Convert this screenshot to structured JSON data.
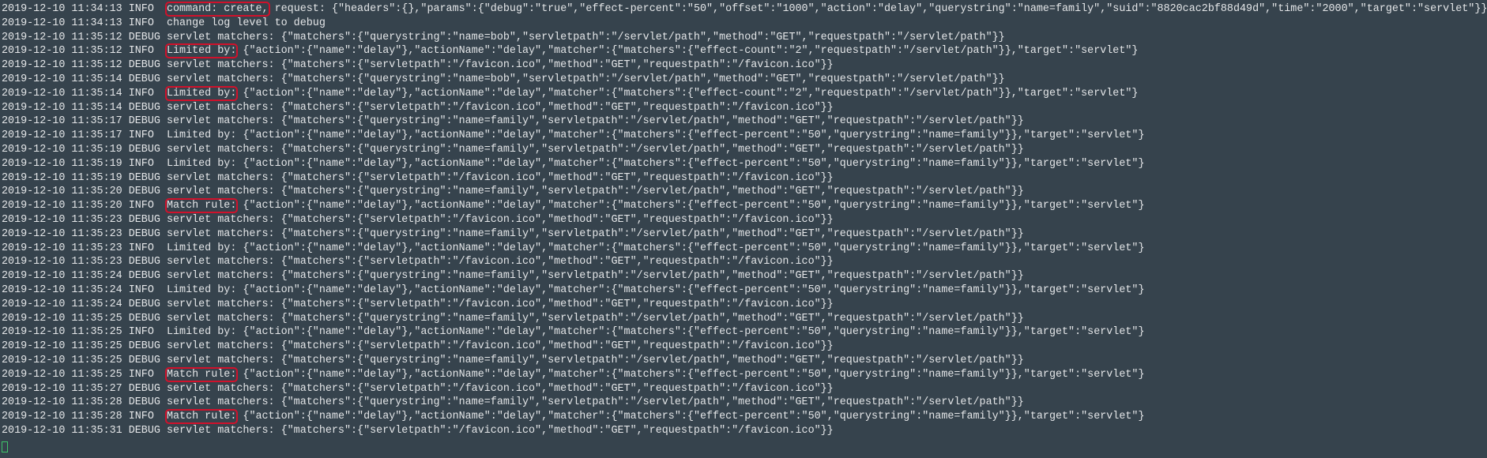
{
  "terminal": {
    "lines": [
      {
        "ts": "2019-12-10 11:34:13",
        "level": "INFO ",
        "prefix": "command: create,",
        "rest": " request: {\"headers\":{},\"params\":{\"debug\":\"true\",\"effect-percent\":\"50\",\"offset\":\"1000\",\"action\":\"delay\",\"querystring\":\"name=family\",\"suid\":\"8820cac2bf88d49d\",\"time\":\"2000\",\"target\":\"servlet\"}}",
        "boxed": true
      },
      {
        "ts": "2019-12-10 11:34:13",
        "level": "INFO ",
        "prefix": "change log level to debug",
        "rest": "",
        "boxed": false
      },
      {
        "ts": "2019-12-10 11:35:12",
        "level": "DEBUG",
        "prefix": "servlet matchers:",
        "rest": " {\"matchers\":{\"querystring\":\"name=bob\",\"servletpath\":\"/servlet/path\",\"method\":\"GET\",\"requestpath\":\"/servlet/path\"}}",
        "boxed": false
      },
      {
        "ts": "2019-12-10 11:35:12",
        "level": "INFO ",
        "prefix": "Limited by:",
        "rest": " {\"action\":{\"name\":\"delay\"},\"actionName\":\"delay\",\"matcher\":{\"matchers\":{\"effect-count\":\"2\",\"requestpath\":\"/servlet/path\"}},\"target\":\"servlet\"}",
        "boxed": true
      },
      {
        "ts": "2019-12-10 11:35:12",
        "level": "DEBUG",
        "prefix": "servlet matchers:",
        "rest": " {\"matchers\":{\"servletpath\":\"/favicon.ico\",\"method\":\"GET\",\"requestpath\":\"/favicon.ico\"}}",
        "boxed": false
      },
      {
        "ts": "2019-12-10 11:35:14",
        "level": "DEBUG",
        "prefix": "servlet matchers:",
        "rest": " {\"matchers\":{\"querystring\":\"name=bob\",\"servletpath\":\"/servlet/path\",\"method\":\"GET\",\"requestpath\":\"/servlet/path\"}}",
        "boxed": false
      },
      {
        "ts": "2019-12-10 11:35:14",
        "level": "INFO ",
        "prefix": "Limited by:",
        "rest": " {\"action\":{\"name\":\"delay\"},\"actionName\":\"delay\",\"matcher\":{\"matchers\":{\"effect-count\":\"2\",\"requestpath\":\"/servlet/path\"}},\"target\":\"servlet\"}",
        "boxed": true
      },
      {
        "ts": "2019-12-10 11:35:14",
        "level": "DEBUG",
        "prefix": "servlet matchers:",
        "rest": " {\"matchers\":{\"servletpath\":\"/favicon.ico\",\"method\":\"GET\",\"requestpath\":\"/favicon.ico\"}}",
        "boxed": false
      },
      {
        "ts": "2019-12-10 11:35:17",
        "level": "DEBUG",
        "prefix": "servlet matchers:",
        "rest": " {\"matchers\":{\"querystring\":\"name=family\",\"servletpath\":\"/servlet/path\",\"method\":\"GET\",\"requestpath\":\"/servlet/path\"}}",
        "boxed": false
      },
      {
        "ts": "2019-12-10 11:35:17",
        "level": "INFO ",
        "prefix": "Limited by:",
        "rest": " {\"action\":{\"name\":\"delay\"},\"actionName\":\"delay\",\"matcher\":{\"matchers\":{\"effect-percent\":\"50\",\"querystring\":\"name=family\"}},\"target\":\"servlet\"}",
        "boxed": false
      },
      {
        "ts": "2019-12-10 11:35:19",
        "level": "DEBUG",
        "prefix": "servlet matchers:",
        "rest": " {\"matchers\":{\"querystring\":\"name=family\",\"servletpath\":\"/servlet/path\",\"method\":\"GET\",\"requestpath\":\"/servlet/path\"}}",
        "boxed": false
      },
      {
        "ts": "2019-12-10 11:35:19",
        "level": "INFO ",
        "prefix": "Limited by:",
        "rest": " {\"action\":{\"name\":\"delay\"},\"actionName\":\"delay\",\"matcher\":{\"matchers\":{\"effect-percent\":\"50\",\"querystring\":\"name=family\"}},\"target\":\"servlet\"}",
        "boxed": false
      },
      {
        "ts": "2019-12-10 11:35:19",
        "level": "DEBUG",
        "prefix": "servlet matchers:",
        "rest": " {\"matchers\":{\"servletpath\":\"/favicon.ico\",\"method\":\"GET\",\"requestpath\":\"/favicon.ico\"}}",
        "boxed": false
      },
      {
        "ts": "2019-12-10 11:35:20",
        "level": "DEBUG",
        "prefix": "servlet matchers:",
        "rest": " {\"matchers\":{\"querystring\":\"name=family\",\"servletpath\":\"/servlet/path\",\"method\":\"GET\",\"requestpath\":\"/servlet/path\"}}",
        "boxed": false
      },
      {
        "ts": "2019-12-10 11:35:20",
        "level": "INFO ",
        "prefix": "Match rule:",
        "rest": " {\"action\":{\"name\":\"delay\"},\"actionName\":\"delay\",\"matcher\":{\"matchers\":{\"effect-percent\":\"50\",\"querystring\":\"name=family\"}},\"target\":\"servlet\"}",
        "boxed": true
      },
      {
        "ts": "2019-12-10 11:35:23",
        "level": "DEBUG",
        "prefix": "servlet matchers:",
        "rest": " {\"matchers\":{\"servletpath\":\"/favicon.ico\",\"method\":\"GET\",\"requestpath\":\"/favicon.ico\"}}",
        "boxed": false
      },
      {
        "ts": "2019-12-10 11:35:23",
        "level": "DEBUG",
        "prefix": "servlet matchers:",
        "rest": " {\"matchers\":{\"querystring\":\"name=family\",\"servletpath\":\"/servlet/path\",\"method\":\"GET\",\"requestpath\":\"/servlet/path\"}}",
        "boxed": false
      },
      {
        "ts": "2019-12-10 11:35:23",
        "level": "INFO ",
        "prefix": "Limited by:",
        "rest": " {\"action\":{\"name\":\"delay\"},\"actionName\":\"delay\",\"matcher\":{\"matchers\":{\"effect-percent\":\"50\",\"querystring\":\"name=family\"}},\"target\":\"servlet\"}",
        "boxed": false
      },
      {
        "ts": "2019-12-10 11:35:23",
        "level": "DEBUG",
        "prefix": "servlet matchers:",
        "rest": " {\"matchers\":{\"servletpath\":\"/favicon.ico\",\"method\":\"GET\",\"requestpath\":\"/favicon.ico\"}}",
        "boxed": false
      },
      {
        "ts": "2019-12-10 11:35:24",
        "level": "DEBUG",
        "prefix": "servlet matchers:",
        "rest": " {\"matchers\":{\"querystring\":\"name=family\",\"servletpath\":\"/servlet/path\",\"method\":\"GET\",\"requestpath\":\"/servlet/path\"}}",
        "boxed": false
      },
      {
        "ts": "2019-12-10 11:35:24",
        "level": "INFO ",
        "prefix": "Limited by:",
        "rest": " {\"action\":{\"name\":\"delay\"},\"actionName\":\"delay\",\"matcher\":{\"matchers\":{\"effect-percent\":\"50\",\"querystring\":\"name=family\"}},\"target\":\"servlet\"}",
        "boxed": false
      },
      {
        "ts": "2019-12-10 11:35:24",
        "level": "DEBUG",
        "prefix": "servlet matchers:",
        "rest": " {\"matchers\":{\"servletpath\":\"/favicon.ico\",\"method\":\"GET\",\"requestpath\":\"/favicon.ico\"}}",
        "boxed": false
      },
      {
        "ts": "2019-12-10 11:35:25",
        "level": "DEBUG",
        "prefix": "servlet matchers:",
        "rest": " {\"matchers\":{\"querystring\":\"name=family\",\"servletpath\":\"/servlet/path\",\"method\":\"GET\",\"requestpath\":\"/servlet/path\"}}",
        "boxed": false
      },
      {
        "ts": "2019-12-10 11:35:25",
        "level": "INFO ",
        "prefix": "Limited by:",
        "rest": " {\"action\":{\"name\":\"delay\"},\"actionName\":\"delay\",\"matcher\":{\"matchers\":{\"effect-percent\":\"50\",\"querystring\":\"name=family\"}},\"target\":\"servlet\"}",
        "boxed": false
      },
      {
        "ts": "2019-12-10 11:35:25",
        "level": "DEBUG",
        "prefix": "servlet matchers:",
        "rest": " {\"matchers\":{\"servletpath\":\"/favicon.ico\",\"method\":\"GET\",\"requestpath\":\"/favicon.ico\"}}",
        "boxed": false
      },
      {
        "ts": "2019-12-10 11:35:25",
        "level": "DEBUG",
        "prefix": "servlet matchers:",
        "rest": " {\"matchers\":{\"querystring\":\"name=family\",\"servletpath\":\"/servlet/path\",\"method\":\"GET\",\"requestpath\":\"/servlet/path\"}}",
        "boxed": false
      },
      {
        "ts": "2019-12-10 11:35:25",
        "level": "INFO ",
        "prefix": "Match rule:",
        "rest": " {\"action\":{\"name\":\"delay\"},\"actionName\":\"delay\",\"matcher\":{\"matchers\":{\"effect-percent\":\"50\",\"querystring\":\"name=family\"}},\"target\":\"servlet\"}",
        "boxed": true
      },
      {
        "ts": "2019-12-10 11:35:27",
        "level": "DEBUG",
        "prefix": "servlet matchers:",
        "rest": " {\"matchers\":{\"servletpath\":\"/favicon.ico\",\"method\":\"GET\",\"requestpath\":\"/favicon.ico\"}}",
        "boxed": false
      },
      {
        "ts": "2019-12-10 11:35:28",
        "level": "DEBUG",
        "prefix": "servlet matchers:",
        "rest": " {\"matchers\":{\"querystring\":\"name=family\",\"servletpath\":\"/servlet/path\",\"method\":\"GET\",\"requestpath\":\"/servlet/path\"}}",
        "boxed": false
      },
      {
        "ts": "2019-12-10 11:35:28",
        "level": "INFO ",
        "prefix": "Match rule:",
        "rest": " {\"action\":{\"name\":\"delay\"},\"actionName\":\"delay\",\"matcher\":{\"matchers\":{\"effect-percent\":\"50\",\"querystring\":\"name=family\"}},\"target\":\"servlet\"}",
        "boxed": true
      },
      {
        "ts": "2019-12-10 11:35:31",
        "level": "DEBUG",
        "prefix": "servlet matchers:",
        "rest": " {\"matchers\":{\"servletpath\":\"/favicon.ico\",\"method\":\"GET\",\"requestpath\":\"/favicon.ico\"}}",
        "boxed": false
      }
    ]
  },
  "colors": {
    "background": "#36434d",
    "text": "#e4e6e8",
    "highlight": "#d0112b",
    "cursor": "#3fc46a"
  }
}
